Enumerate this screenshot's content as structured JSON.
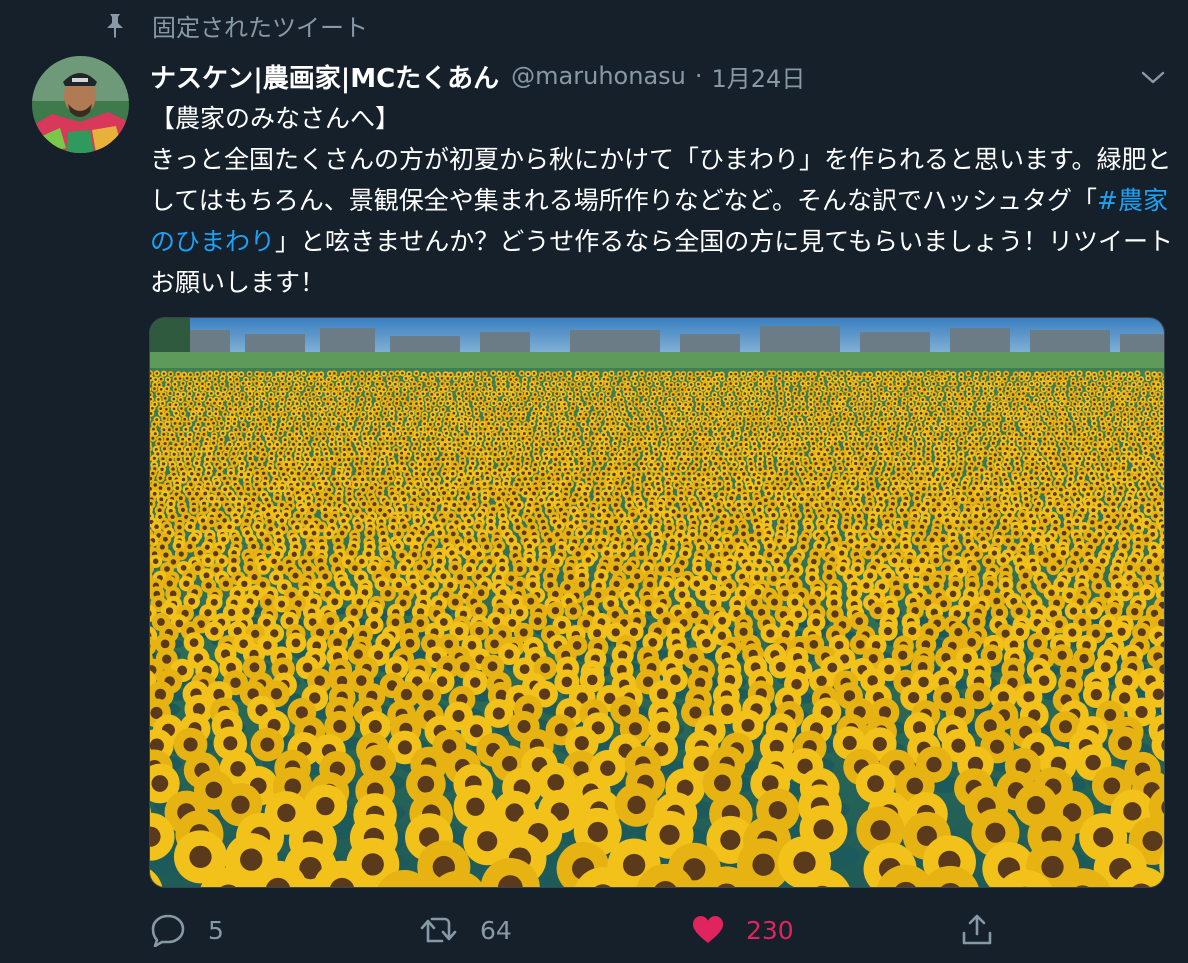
{
  "pinned_label": "固定されたツイート",
  "author": {
    "display_name": "ナスケン|農画家|MCたくあん",
    "handle": "@maruhonasu",
    "separator": "·",
    "date": "1月24日"
  },
  "tweet": {
    "line1": "【農家のみなさんへ】",
    "line2_before": "きっと全国たくさんの方が初夏から秋にかけて「ひまわり」を作られると思います。緑肥としてはもちろん、景観保全や集まれる場所作りなどなど。そんな訳でハッシュタグ「",
    "hashtag": "#農家のひまわり",
    "line2_after": "」と呟きませんか？どうせ作るなら全国の方に見てもらいましょう！リツイートお願いします！"
  },
  "media": {
    "description_icon": "sunflower-field-photo"
  },
  "actions": {
    "reply_count": "5",
    "retweet_count": "64",
    "like_count": "230"
  },
  "colors": {
    "background": "#15202b",
    "text": "#ffffff",
    "muted": "#8899a6",
    "link": "#1da1f2",
    "like": "#e0245e"
  }
}
